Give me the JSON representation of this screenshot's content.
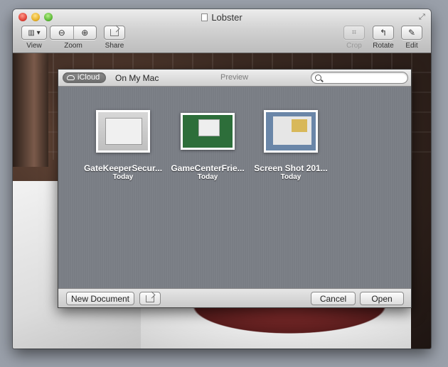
{
  "window": {
    "title": "Lobster"
  },
  "toolbar": {
    "view_label": "View",
    "zoom_label": "Zoom",
    "share_label": "Share",
    "crop_label": "Crop",
    "rotate_label": "Rotate",
    "edit_label": "Edit"
  },
  "sheet": {
    "icloud_label": "iCloud",
    "onmymac_label": "On My Mac",
    "preview_label": "Preview",
    "search_placeholder": "",
    "files": [
      {
        "name": "GateKeeperSecur...",
        "date": "Today"
      },
      {
        "name": "GameCenterFrie...",
        "date": "Today"
      },
      {
        "name": "Screen Shot 201...",
        "date": "Today"
      }
    ],
    "new_document_label": "New Document",
    "cancel_label": "Cancel",
    "open_label": "Open"
  }
}
